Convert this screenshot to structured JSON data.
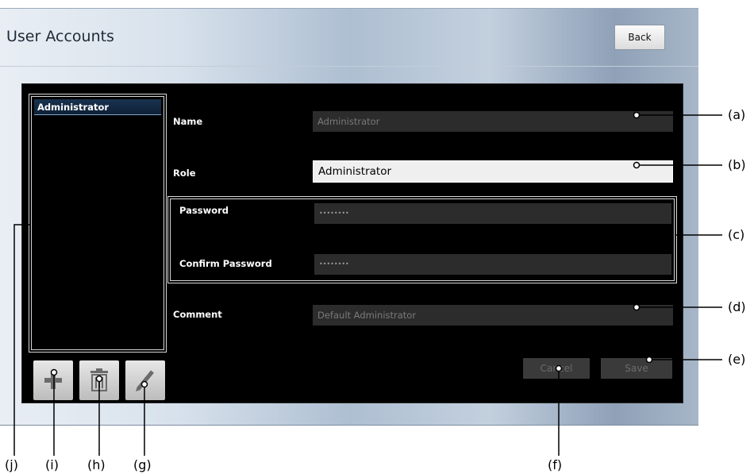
{
  "window": {
    "title": "User Accounts",
    "back_label": "Back"
  },
  "user_list": {
    "items": [
      {
        "label": "Administrator",
        "selected": true
      }
    ]
  },
  "toolbar": {
    "add_icon": "plus-icon",
    "delete_icon": "trash-icon",
    "edit_icon": "pencil-icon"
  },
  "form": {
    "name_label": "Name",
    "name_value": "Administrator",
    "role_label": "Role",
    "role_value": "Administrator",
    "password_label": "Password",
    "password_value": "••••••••",
    "confirm_label": "Confirm Password",
    "confirm_value": "••••••••",
    "comment_label": "Comment",
    "comment_value": "Default Administrator",
    "cancel_label": "Cancel",
    "save_label": "Save"
  },
  "callouts": {
    "a": "(a)",
    "b": "(b)",
    "c": "(c)",
    "d": "(d)",
    "e": "(e)",
    "f": "(f)",
    "g": "(g)",
    "h": "(h)",
    "i": "(i)",
    "j": "(j)"
  },
  "colors": {
    "panel_bg": "#000000",
    "field_bg": "#2c2c2c",
    "selection": "#1a3250"
  }
}
